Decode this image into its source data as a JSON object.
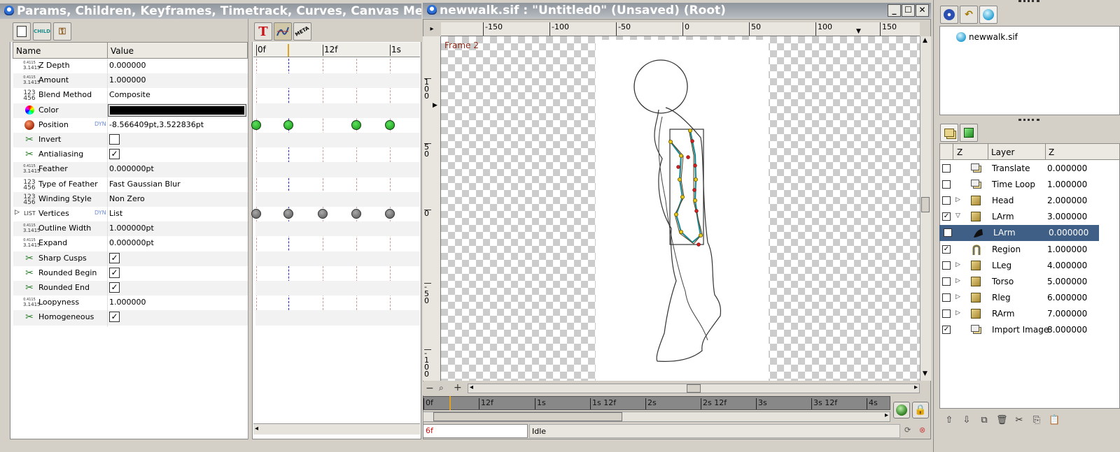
{
  "params_window": {
    "title": "Params, Children, Keyframes, Timetrack, Curves, Canvas Meta",
    "tabs": [
      {
        "label": "CHILD"
      }
    ],
    "columns": {
      "name": "Name",
      "value": "Value"
    },
    "rows": [
      {
        "icon": "real",
        "name": "Z Depth",
        "value": "0.000000"
      },
      {
        "icon": "real",
        "name": "Amount",
        "value": "1.000000"
      },
      {
        "icon": "int",
        "name": "Blend Method",
        "value": "Composite"
      },
      {
        "icon": "color",
        "name": "Color",
        "value": "",
        "color": "#000000"
      },
      {
        "icon": "vector",
        "name": "Position",
        "dyn": "DYN",
        "value": "-8.566409pt,3.522836pt"
      },
      {
        "icon": "bool",
        "name": "Invert",
        "checked": false
      },
      {
        "icon": "bool",
        "name": "Antialiasing",
        "checked": true
      },
      {
        "icon": "real",
        "name": "Feather",
        "value": "0.000000pt"
      },
      {
        "icon": "int",
        "name": "Type of Feather",
        "value": "Fast Gaussian Blur"
      },
      {
        "icon": "int",
        "name": "Winding Style",
        "value": "Non Zero"
      },
      {
        "icon": "list",
        "name": "Vertices",
        "dyn": "DYN",
        "value": "List",
        "list_label": "LIST"
      },
      {
        "icon": "real",
        "name": "Outline Width",
        "value": "1.000000pt"
      },
      {
        "icon": "real",
        "name": "Expand",
        "value": "0.000000pt"
      },
      {
        "icon": "bool",
        "name": "Sharp Cusps",
        "checked": true
      },
      {
        "icon": "bool",
        "name": "Rounded Begin",
        "checked": true
      },
      {
        "icon": "bool",
        "name": "Rounded End",
        "checked": true
      },
      {
        "icon": "real",
        "name": "Loopyness",
        "value": "1.000000"
      },
      {
        "icon": "bool",
        "name": "Homogeneous",
        "checked": true
      }
    ]
  },
  "timetrack": {
    "tabs": [
      {
        "label": "T"
      },
      {
        "label": "curve"
      },
      {
        "label": "META"
      }
    ],
    "ticks": [
      "0f",
      "12f",
      "1s"
    ]
  },
  "canvas_window": {
    "title": "newwalk.sif : \"Untitled0\" (Unsaved) (Root)",
    "frame_label": "Frame 2",
    "ruler_h": [
      "-150",
      "-100",
      "-50",
      "0",
      "50",
      "100",
      "150"
    ],
    "ruler_v": [
      "100",
      "50",
      "0",
      "-50",
      "-100"
    ],
    "timebar": [
      "0f",
      "12f",
      "1s",
      "1s 12f",
      "2s",
      "2s 12f",
      "3s",
      "3s 12f",
      "4s"
    ],
    "current_time": "6f",
    "status": "Idle"
  },
  "canvas_browser": {
    "items": [
      {
        "label": "newwalk.sif"
      }
    ]
  },
  "layers_panel": {
    "columns": {
      "z": "Z",
      "layer": "Layer",
      "zdepth": "Z"
    },
    "rows": [
      {
        "checked": false,
        "expander": "",
        "icon": "translate",
        "name": "Translate",
        "z": "0.000000"
      },
      {
        "checked": false,
        "expander": "",
        "icon": "translate",
        "name": "Time Loop",
        "z": "1.000000"
      },
      {
        "checked": false,
        "expander": "▷",
        "icon": "group",
        "name": "Head",
        "z": "2.000000"
      },
      {
        "checked": true,
        "expander": "▽",
        "icon": "group",
        "name": "LArm",
        "z": "3.000000"
      },
      {
        "checked": true,
        "expander": "",
        "icon": "outline",
        "name": "LArm",
        "z": "0.000000",
        "selected": true
      },
      {
        "checked": true,
        "expander": "",
        "icon": "region",
        "name": "Region",
        "z": "1.000000"
      },
      {
        "checked": false,
        "expander": "▷",
        "icon": "group",
        "name": "LLeg",
        "z": "4.000000"
      },
      {
        "checked": false,
        "expander": "▷",
        "icon": "group",
        "name": "Torso",
        "z": "5.000000"
      },
      {
        "checked": false,
        "expander": "▷",
        "icon": "group",
        "name": "Rleg",
        "z": "6.000000"
      },
      {
        "checked": false,
        "expander": "▷",
        "icon": "group",
        "name": "RArm",
        "z": "7.000000"
      },
      {
        "checked": true,
        "expander": "",
        "icon": "translate",
        "name": "Import Image",
        "z": "8.000000"
      }
    ]
  }
}
